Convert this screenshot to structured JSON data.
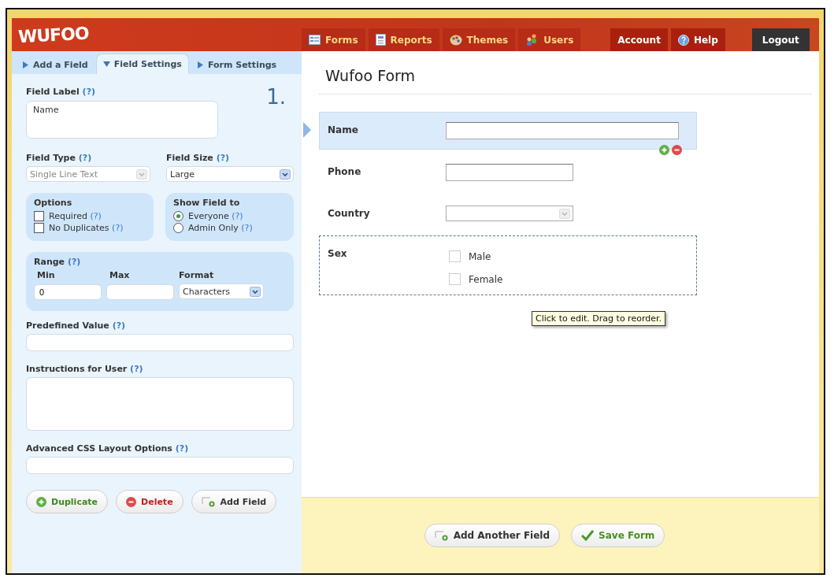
{
  "logo": "WUFOO",
  "nav": [
    {
      "label": "Forms",
      "kind": "forms"
    },
    {
      "label": "Reports",
      "kind": "reports"
    },
    {
      "label": "Themes",
      "kind": "themes"
    },
    {
      "label": "Users",
      "kind": "users"
    }
  ],
  "account": {
    "account": "Account",
    "help": "Help",
    "logout": "Logout"
  },
  "panel_tabs": [
    {
      "label": "Add a Field",
      "selected": false
    },
    {
      "label": "Field Settings",
      "selected": true
    },
    {
      "label": "Form Settings",
      "selected": false
    }
  ],
  "field_number": "1.",
  "field_label": {
    "label": "Field Label",
    "help": "(?)",
    "value": "Name"
  },
  "field_type": {
    "label": "Field Type",
    "help": "(?)",
    "value": "Single Line Text",
    "disabled": true
  },
  "field_size": {
    "label": "Field Size",
    "help": "(?)",
    "value": "Large",
    "disabled": false
  },
  "options": {
    "title": "Options",
    "items": [
      {
        "label": "Required",
        "help": "(?)",
        "checked": false
      },
      {
        "label": "No Duplicates",
        "help": "(?)",
        "checked": false
      }
    ]
  },
  "show_field_to": {
    "title": "Show Field to",
    "items": [
      {
        "label": "Everyone",
        "help": "(?)",
        "selected": true
      },
      {
        "label": "Admin Only",
        "help": "(?)",
        "selected": false
      }
    ]
  },
  "range": {
    "title": "Range",
    "help": "(?)",
    "min": {
      "label": "Min",
      "value": "0"
    },
    "max": {
      "label": "Max"
    },
    "format": {
      "label": "Format",
      "value": "Characters"
    }
  },
  "predefined_value": {
    "label": "Predefined Value",
    "help": "(?)"
  },
  "instructions": {
    "label": "Instructions for User",
    "help": "(?)"
  },
  "advanced_css": {
    "label": "Advanced CSS Layout Options",
    "help": "(?)"
  },
  "panel_buttons": [
    {
      "label": "Duplicate",
      "kind": "duplicate"
    },
    {
      "label": "Delete",
      "kind": "delete"
    },
    {
      "label": "Add Field",
      "kind": "add"
    }
  ],
  "form": {
    "title": "Wufoo Form",
    "fields": [
      {
        "label": "Name",
        "kind": "longtext",
        "selected": true,
        "hovered": false
      },
      {
        "label": "Phone",
        "kind": "shorttext",
        "selected": false,
        "hovered": false
      },
      {
        "label": "Country",
        "kind": "select",
        "selected": false,
        "hovered": false
      },
      {
        "label": "Sex",
        "kind": "checkboxes",
        "selected": false,
        "hovered": true,
        "options": [
          {
            "label": "Male",
            "checked": false
          },
          {
            "label": "Female",
            "checked": false
          }
        ]
      }
    ]
  },
  "tooltip": "Click to edit. Drag to reorder.",
  "footer_buttons": [
    {
      "label": "Add Another Field",
      "kind": "add"
    },
    {
      "label": "Save Form",
      "kind": "save"
    }
  ]
}
